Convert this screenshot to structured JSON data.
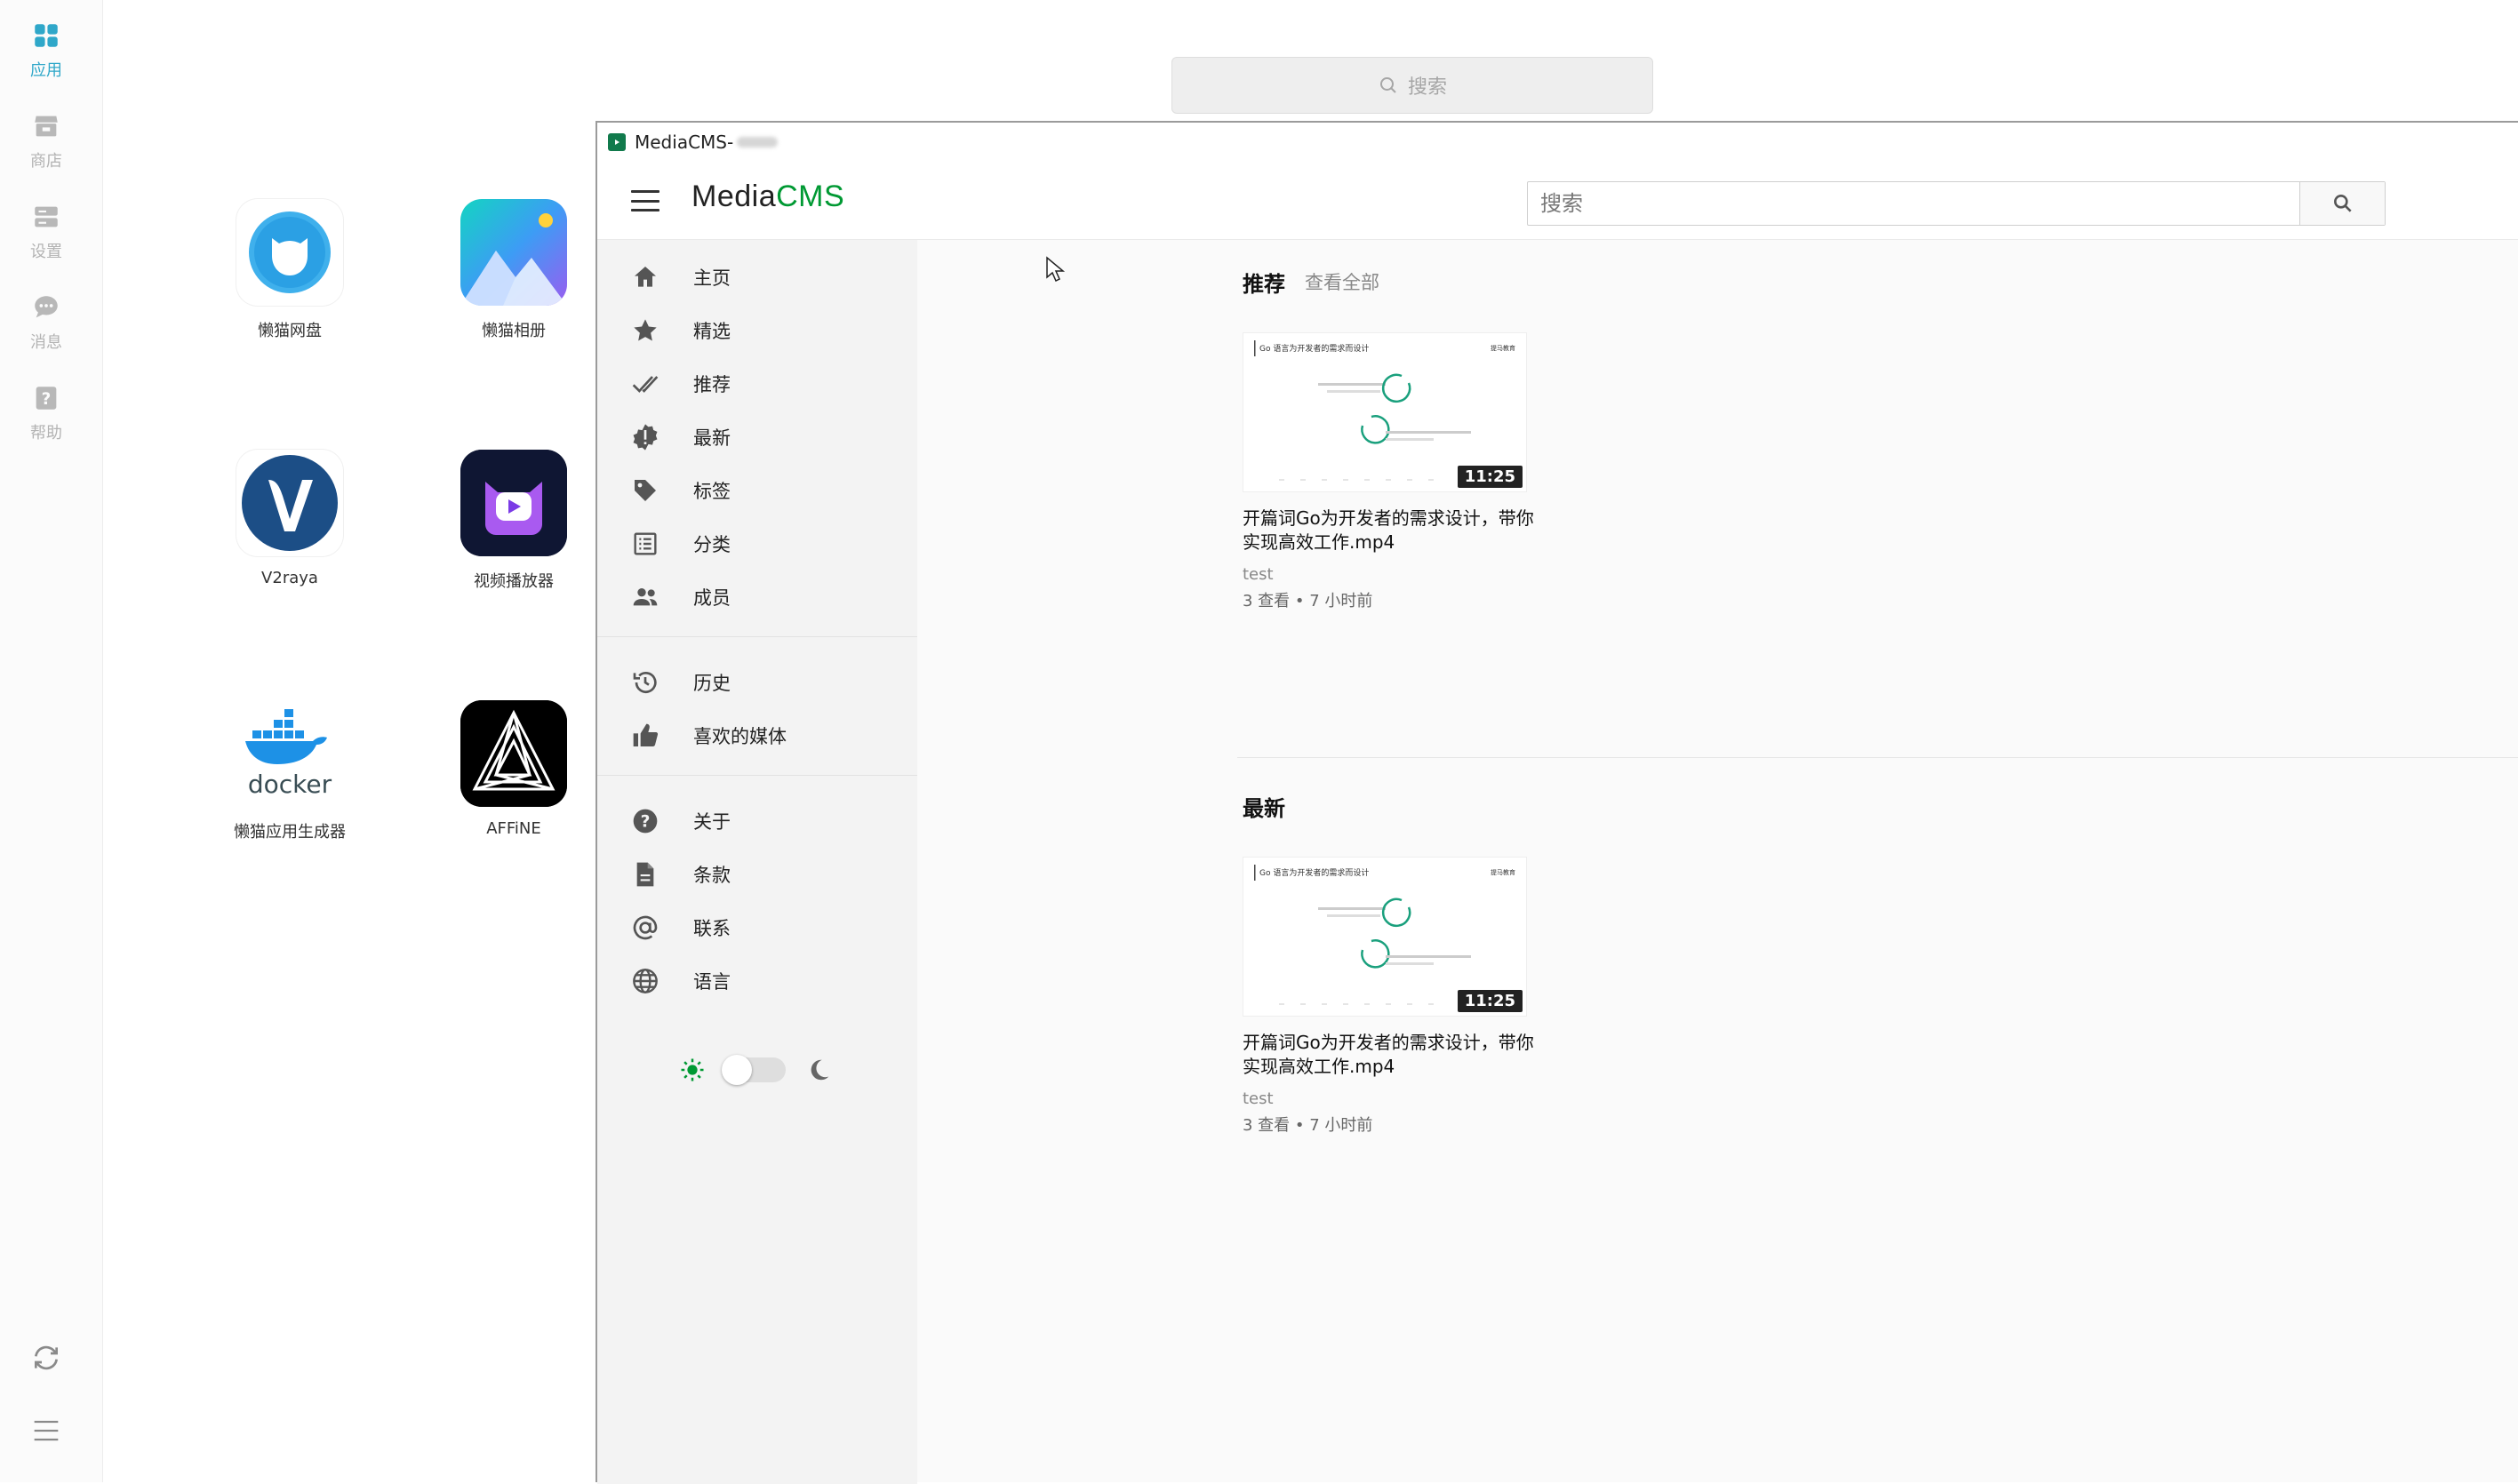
{
  "desktop": {
    "rail": {
      "items": [
        {
          "label": "应用",
          "icon": "grid-icon",
          "active": true
        },
        {
          "label": "商店",
          "icon": "store-icon",
          "active": false
        },
        {
          "label": "设置",
          "icon": "server-icon",
          "active": false
        },
        {
          "label": "消息",
          "icon": "chat-icon",
          "active": false
        },
        {
          "label": "帮助",
          "icon": "help-icon",
          "active": false
        }
      ],
      "bottom": [
        {
          "icon": "refresh-icon"
        },
        {
          "icon": "menu-icon"
        }
      ],
      "accent_color": "#2fa7c9"
    },
    "search": {
      "placeholder": "搜索"
    },
    "apps": [
      {
        "label": "懒猫网盘",
        "icon": "lazycat-drive-icon"
      },
      {
        "label": "懒猫相册",
        "icon": "lazycat-photos-icon"
      },
      {
        "label": "V2raya",
        "icon": "v2raya-icon"
      },
      {
        "label": "视频播放器",
        "icon": "video-player-icon"
      },
      {
        "label": "懒猫应用生成器",
        "icon": "docker-icon"
      },
      {
        "label": "AFFiNE",
        "icon": "affine-icon"
      }
    ]
  },
  "window": {
    "title": "MediaCMS-",
    "logo": {
      "part1": "Media",
      "part2": "CMS",
      "accent_color": "#009933"
    },
    "search": {
      "placeholder": "搜索"
    },
    "sidebar": {
      "group1": [
        {
          "label": "主页",
          "icon": "home-icon"
        },
        {
          "label": "精选",
          "icon": "star-icon"
        },
        {
          "label": "推荐",
          "icon": "double-check-icon"
        },
        {
          "label": "最新",
          "icon": "new-badge-icon"
        },
        {
          "label": "标签",
          "icon": "tag-icon"
        },
        {
          "label": "分类",
          "icon": "list-icon"
        },
        {
          "label": "成员",
          "icon": "people-icon"
        }
      ],
      "group2": [
        {
          "label": "历史",
          "icon": "history-icon"
        },
        {
          "label": "喜欢的媒体",
          "icon": "thumb-up-icon"
        }
      ],
      "group3": [
        {
          "label": "关于",
          "icon": "question-icon"
        },
        {
          "label": "条款",
          "icon": "document-icon"
        },
        {
          "label": "联系",
          "icon": "at-icon"
        },
        {
          "label": "语言",
          "icon": "globe-icon"
        }
      ],
      "theme": {
        "mode": "light",
        "sun_color": "#009933"
      }
    },
    "sections": [
      {
        "title": "推荐",
        "link": "查看全部",
        "video": {
          "title": "开篇词Go为开发者的需求设计，带你实现高效工作.mp4",
          "duration": "11:25",
          "author": "test",
          "meta": "3 查看 • 7 小时前",
          "thumb_heading": "Go 语言为开发者的需求而设计",
          "thumb_corner": "提马教育"
        }
      },
      {
        "title": "最新",
        "link": "",
        "video": {
          "title": "开篇词Go为开发者的需求设计，带你实现高效工作.mp4",
          "duration": "11:25",
          "author": "test",
          "meta": "3 查看 • 7 小时前",
          "thumb_heading": "Go 语言为开发者的需求而设计",
          "thumb_corner": "提马教育"
        }
      }
    ]
  }
}
